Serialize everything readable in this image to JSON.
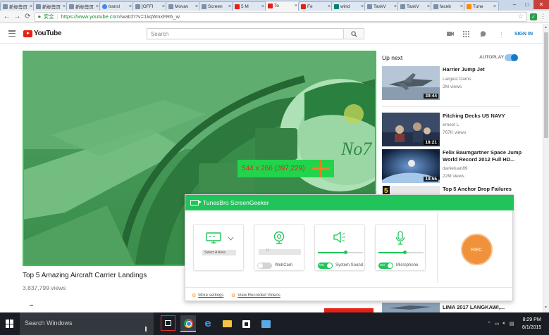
{
  "browser": {
    "tabs": [
      {
        "label": "新标签页",
        "favicon": "page-icon"
      },
      {
        "label": "新标签页",
        "favicon": "page-icon"
      },
      {
        "label": "新标签页",
        "favicon": "page-icon"
      },
      {
        "label": "transl",
        "favicon": "google-icon"
      },
      {
        "label": "[OFFI",
        "favicon": "page-icon"
      },
      {
        "label": "Movav",
        "favicon": "page-icon"
      },
      {
        "label": "Screen",
        "favicon": "page-icon"
      },
      {
        "label": "5 M",
        "favicon": "youtube-icon"
      },
      {
        "label": "To",
        "favicon": "youtube-icon",
        "active": true
      },
      {
        "label": "Fe",
        "favicon": "youtube-icon"
      },
      {
        "label": "wind",
        "favicon": "bing-icon"
      },
      {
        "label": "TaskV",
        "favicon": "page-icon"
      },
      {
        "label": "TaskV",
        "favicon": "page-icon"
      },
      {
        "label": "faceb",
        "favicon": "page-icon"
      },
      {
        "label": "Tune",
        "favicon": "tunesbro-icon"
      }
    ],
    "close_glyph": "×",
    "secure_label": "安全",
    "url_host": "https://www.youtube.com",
    "url_path": "/watch?v=1kqWnxFR6_w"
  },
  "youtube": {
    "logo_text": "YouTube",
    "search_placeholder": "Search",
    "signin_label": "SIGN IN",
    "video_title": "Top 5 Amazing Aircraft Carrier Landings",
    "video_views": "3,837,799 views",
    "upnext_label": "Up next",
    "autoplay_label": "AUTOPLAY",
    "autoplay_on": true,
    "related": [
      {
        "title": "Harrier Jump Jet",
        "channel": "Largest Dams",
        "views": "2M views",
        "duration": "39:44"
      },
      {
        "title": "Pitching Decks US NAVY",
        "channel": "ernest L",
        "views": "767K views",
        "duration": "18:21"
      },
      {
        "title": "Felix Baumgartner Space Jump World Record 2012 Full HD...",
        "channel": "danieluan89",
        "views": "22M views",
        "duration": "19:55"
      },
      {
        "title": "Top 5 Anchor Drop Failures",
        "channel": "",
        "views": "",
        "duration": ""
      }
    ],
    "partial_title": "LIMA 2017 LANGKAWI,..."
  },
  "capture": {
    "dimension_label": "544 x 266 (397,229)"
  },
  "screengeeker": {
    "title": "TunesBro ScreenGeeker",
    "select_area": "Select A Area",
    "webcam": "WebCam",
    "webcam_on": false,
    "system_sound": "System Sound",
    "system_sound_on": true,
    "system_sound_level": 0.62,
    "microphone": "Microphone",
    "microphone_on": true,
    "microphone_level": 0.58,
    "toggle_on_text": "ON",
    "rec_label": "REC",
    "more_settings": "More settings",
    "view_recorded": "View Recorded Videos"
  },
  "taskbar": {
    "search_text": "Search Windows",
    "time": "8:29 PM",
    "date": "8/1/2015"
  }
}
